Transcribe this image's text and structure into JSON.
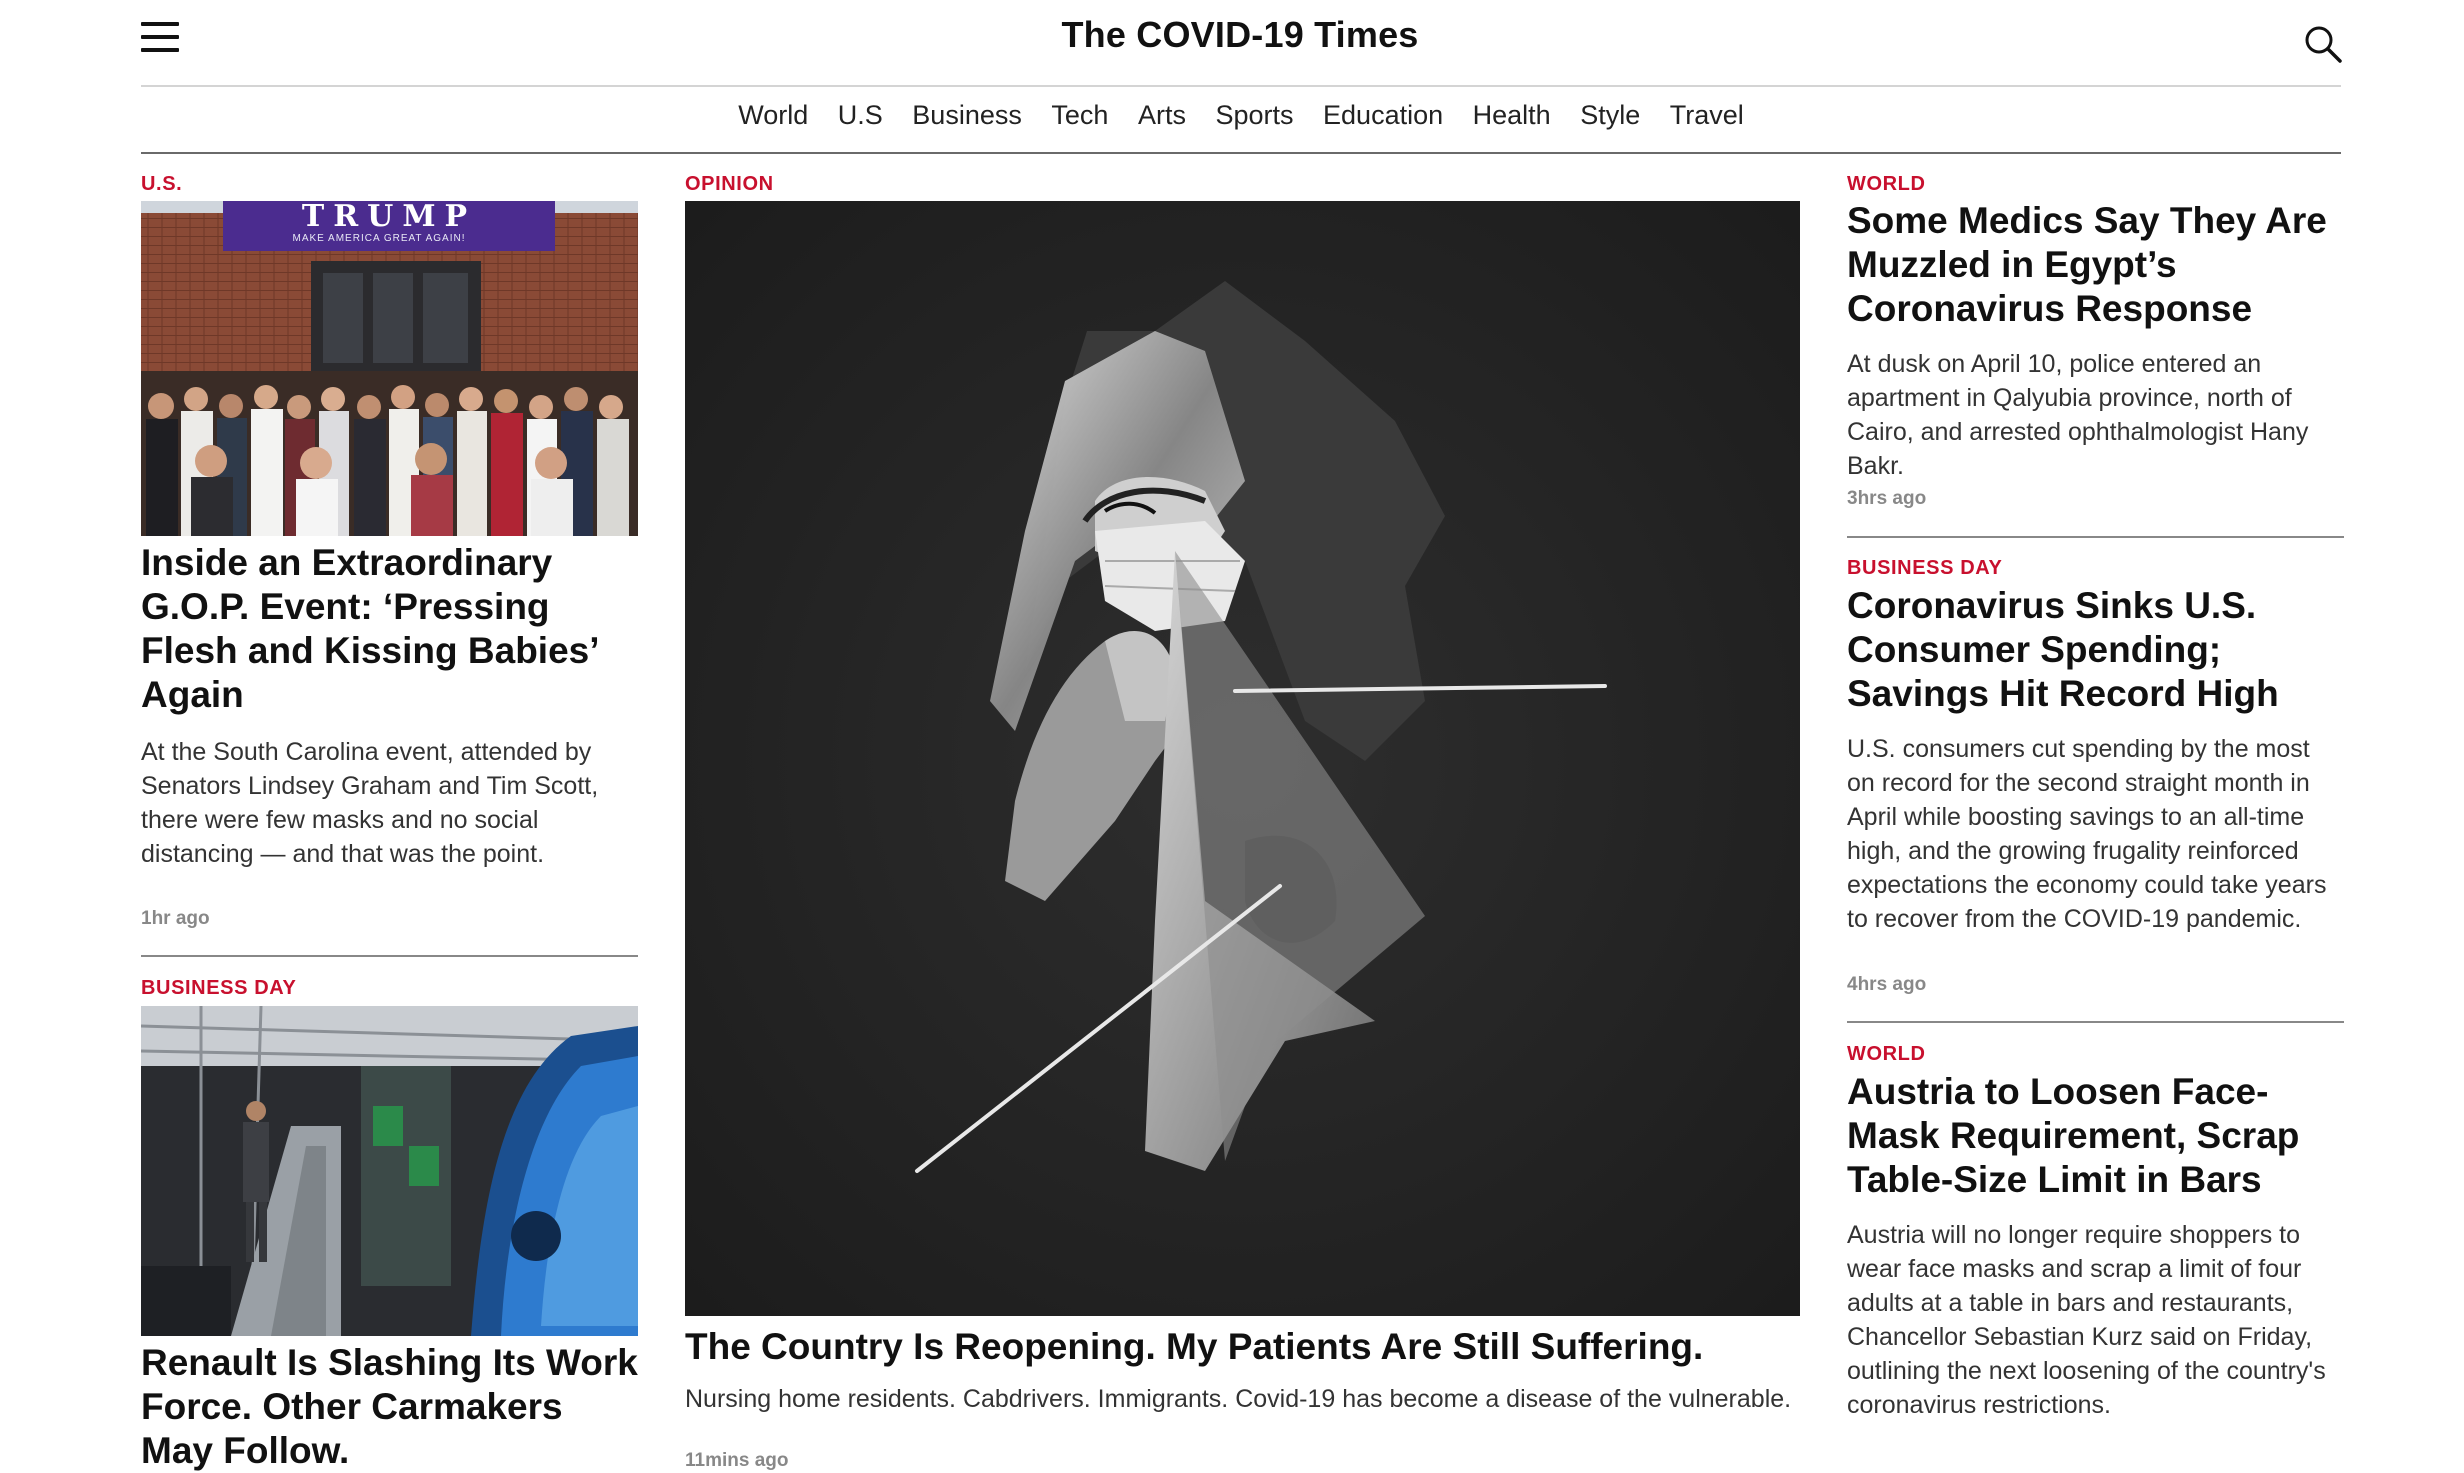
{
  "header": {
    "site_title": "The COVID-19 Times",
    "menu_icon": "hamburger-menu-icon",
    "search_icon": "search-icon"
  },
  "nav": {
    "items": [
      "World",
      "U.S",
      "Business",
      "Tech",
      "Arts",
      "Sports",
      "Education",
      "Health",
      "Style",
      "Travel"
    ]
  },
  "left_column": {
    "articles": [
      {
        "kicker": "U.S.",
        "banner_title": "TRUMP",
        "banner_subtitle": "MAKE AMERICA GREAT AGAIN!",
        "headline": "Inside an Extraordinary G.O.P. Event: ‘Pressing Flesh and Kissing Babies’ Again",
        "summary": "At the South Carolina event, attended by Senators Lindsey Graham and Tim Scott, there were few masks and no social distancing — and that was the point.",
        "time": "1hr ago"
      },
      {
        "kicker": "BUSINESS DAY",
        "headline": "Renault Is Slashing Its Work Force. Other Carmakers May Follow."
      }
    ]
  },
  "center_column": {
    "kicker": "OPINION",
    "headline": "The Country Is Reopening. My Patients Are Still Suffering.",
    "summary": "Nursing home residents. Cabdrivers. Immigrants. Covid-19 has become a disease of the vulnerable.",
    "time": "11mins ago"
  },
  "right_column": {
    "articles": [
      {
        "kicker": "WORLD",
        "headline": "Some Medics Say They Are Muzzled in Egypt’s Coronavirus Response",
        "summary": "At dusk on April 10, police entered an apartment in Qalyubia province, north of Cairo, and arrested ophthalmologist Hany Bakr.",
        "time": "3hrs ago"
      },
      {
        "kicker": "BUSINESS DAY",
        "headline": "Coronavirus Sinks U.S. Consumer Spending; Savings Hit Record High",
        "summary": "U.S. consumers cut spending by the most on record for the second straight month in April while boosting savings to an all-time high, and the growing frugality reinforced expectations the economy could take years to recover from the COVID-19 pandemic.",
        "time": "4hrs ago"
      },
      {
        "kicker": "WORLD",
        "headline": "Austria to Loosen Face-Mask Requirement, Scrap Table-Size Limit in Bars",
        "summary": "Austria will no longer require shoppers to wear face masks and scrap a limit of four adults at a table in bars and restaurants, Chancellor Sebastian Kurz said on Friday, outlining the next loosening of the country's coronavirus restrictions."
      }
    ]
  },
  "colors": {
    "kicker_red": "#c8102e",
    "text": "#111111",
    "muted": "#888888"
  }
}
